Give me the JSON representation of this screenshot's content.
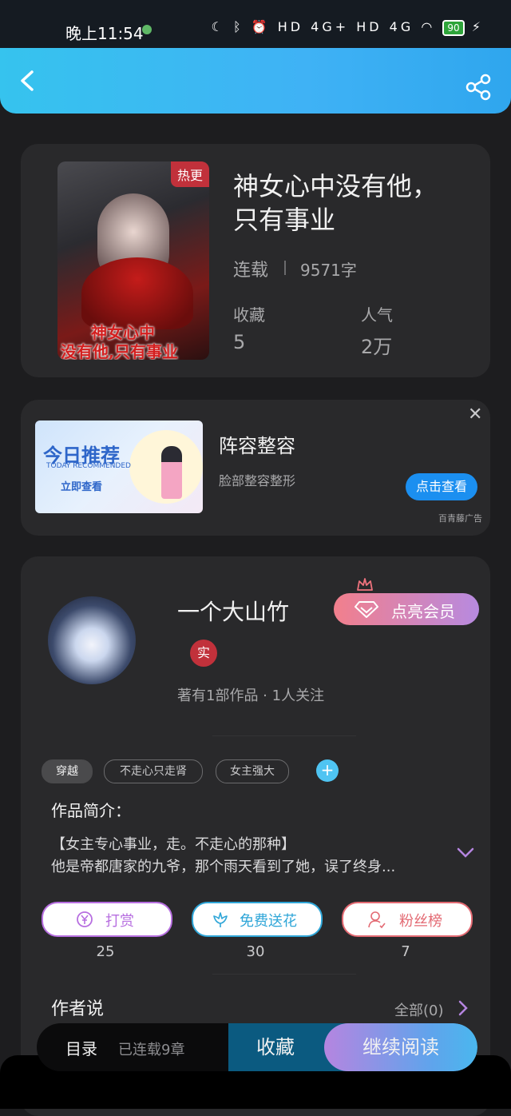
{
  "status_bar": {
    "time": "晚上11:54",
    "network": "HD 4G+ HD 4G",
    "battery": "90"
  },
  "book": {
    "hot_badge": "热更",
    "cover_text_line1": "神女心中",
    "cover_text_line2": "没有他,只有事业",
    "title": "神女心中没有他，只有事业",
    "status": "连载",
    "word_count": "9571字",
    "favorites_label": "收藏",
    "favorites_value": "5",
    "popularity_label": "人气",
    "popularity_value": "2万"
  },
  "ad": {
    "banner_title": "今日推荐",
    "banner_subtitle": "TODAY RECOMMENDED",
    "banner_cta": "立即查看",
    "title": "阵容整容",
    "subtitle": "脸部整容整形",
    "button": "点击查看",
    "source": "百青藤广告",
    "close": "✕"
  },
  "author": {
    "name": "一个大山竹",
    "verified_badge": "实",
    "meta": "著有1部作品 · 1人关注",
    "vip_button": "点亮会员"
  },
  "tags": [
    "穿越",
    "不走心只走肾",
    "女主强大"
  ],
  "add_tag": "+",
  "intro": {
    "title": "作品简介：",
    "line1": "【女主专心事业，走。不走心的那种】",
    "line2": "他是帝都唐家的九爷，那个雨天看到了她，误了终身..."
  },
  "actions": [
    {
      "label": "打赏",
      "count": "25",
      "color": "#b76fe0"
    },
    {
      "label": "免费送花",
      "count": "30",
      "color": "#2fa6d8"
    },
    {
      "label": "粉丝榜",
      "count": "7",
      "color": "#e36a73"
    }
  ],
  "author_says": {
    "title": "作者说",
    "all": "全部(0)"
  },
  "bottom_bar": {
    "toc": "目录",
    "serialized": "已连载9章",
    "collect": "收藏",
    "continue": "继续阅读"
  }
}
